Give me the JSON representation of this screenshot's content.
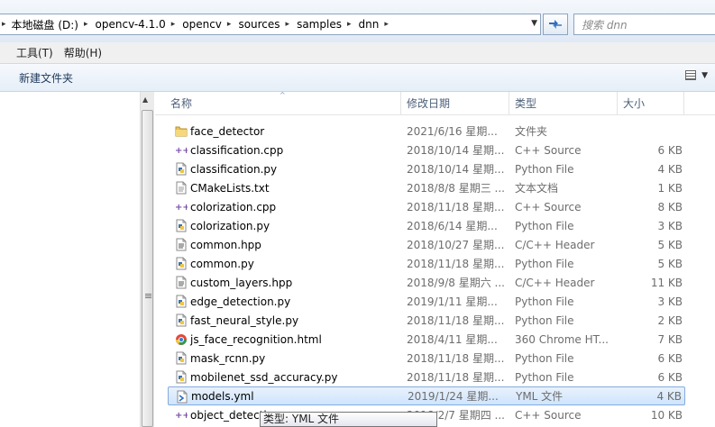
{
  "address": {
    "crumbs": [
      "本地磁盘 (D:)",
      "opencv-4.1.0",
      "opencv",
      "sources",
      "samples",
      "dnn"
    ],
    "search_placeholder": "搜索 dnn"
  },
  "menu": [
    "工具(T)",
    "帮助(H)"
  ],
  "toolbar": {
    "new_folder": "新建文件夹"
  },
  "columns": {
    "name": "名称",
    "date": "修改日期",
    "type": "类型",
    "size": "大小"
  },
  "files": [
    {
      "name": "face_detector",
      "date": "2021/6/16 星期...",
      "type": "文件夹",
      "size": "",
      "icon": "folder-icon"
    },
    {
      "name": "classification.cpp",
      "date": "2018/10/14 星期...",
      "type": "C++ Source",
      "size": "6 KB",
      "icon": "cpp-file-icon"
    },
    {
      "name": "classification.py",
      "date": "2018/10/14 星期...",
      "type": "Python File",
      "size": "4 KB",
      "icon": "python-file-icon"
    },
    {
      "name": "CMakeLists.txt",
      "date": "2018/8/8 星期三 ...",
      "type": "文本文档",
      "size": "1 KB",
      "icon": "text-file-icon"
    },
    {
      "name": "colorization.cpp",
      "date": "2018/11/18 星期...",
      "type": "C++ Source",
      "size": "8 KB",
      "icon": "cpp-file-icon"
    },
    {
      "name": "colorization.py",
      "date": "2018/6/14 星期...",
      "type": "Python File",
      "size": "3 KB",
      "icon": "python-file-icon"
    },
    {
      "name": "common.hpp",
      "date": "2018/10/27 星期...",
      "type": "C/C++ Header",
      "size": "5 KB",
      "icon": "header-file-icon"
    },
    {
      "name": "common.py",
      "date": "2018/11/18 星期...",
      "type": "Python File",
      "size": "5 KB",
      "icon": "python-file-icon"
    },
    {
      "name": "custom_layers.hpp",
      "date": "2018/9/8 星期六 ...",
      "type": "C/C++ Header",
      "size": "11 KB",
      "icon": "header-file-icon"
    },
    {
      "name": "edge_detection.py",
      "date": "2019/1/11 星期...",
      "type": "Python File",
      "size": "3 KB",
      "icon": "python-file-icon"
    },
    {
      "name": "fast_neural_style.py",
      "date": "2018/11/18 星期...",
      "type": "Python File",
      "size": "2 KB",
      "icon": "python-file-icon"
    },
    {
      "name": "js_face_recognition.html",
      "date": "2018/4/11 星期...",
      "type": "360 Chrome HT...",
      "size": "7 KB",
      "icon": "chrome-html-icon"
    },
    {
      "name": "mask_rcnn.py",
      "date": "2018/11/18 星期...",
      "type": "Python File",
      "size": "6 KB",
      "icon": "python-file-icon"
    },
    {
      "name": "mobilenet_ssd_accuracy.py",
      "date": "2018/11/18 星期...",
      "type": "Python File",
      "size": "6 KB",
      "icon": "python-file-icon"
    },
    {
      "name": "models.yml",
      "date": "2019/1/24 星期...",
      "type": "YML 文件",
      "size": "4 KB",
      "icon": "yml-file-icon",
      "selected": true
    },
    {
      "name": "object_detection.cpp",
      "date": "2018/2/7 星期四 ...",
      "type": "C++ Source",
      "size": "10 KB",
      "icon": "cpp-file-icon"
    }
  ],
  "tooltip": "类型: YML 文件"
}
